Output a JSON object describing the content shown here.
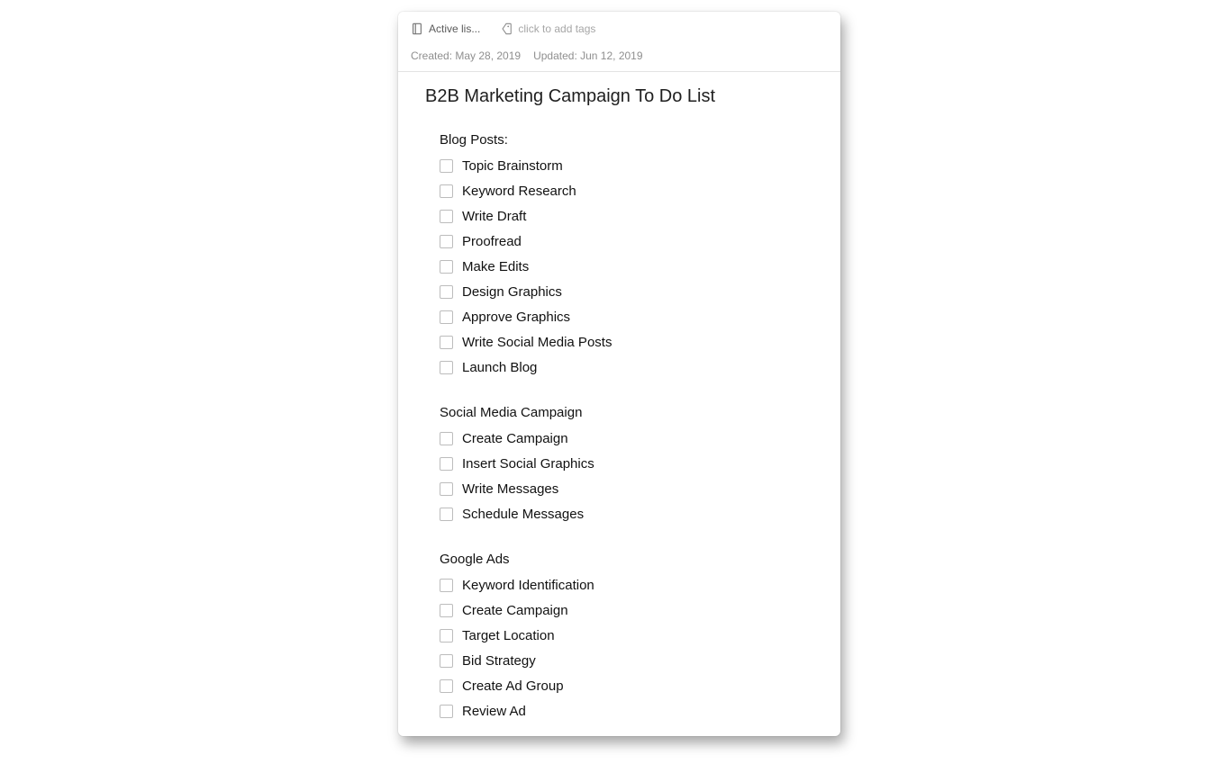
{
  "header": {
    "notebook_label": "Active lis...",
    "tags_placeholder": "click to add tags"
  },
  "meta": {
    "created": "Created: May 28, 2019",
    "updated": "Updated: Jun 12, 2019"
  },
  "note": {
    "title": "B2B Marketing Campaign To Do List"
  },
  "sections": [
    {
      "heading": "Blog Posts:",
      "items": [
        "Topic Brainstorm",
        "Keyword Research",
        "Write Draft",
        "Proofread",
        "Make Edits",
        "Design Graphics",
        "Approve Graphics",
        "Write Social Media Posts",
        "Launch Blog"
      ]
    },
    {
      "heading": "Social Media Campaign",
      "items": [
        "Create Campaign",
        "Insert Social Graphics",
        "Write Messages",
        "Schedule Messages"
      ]
    },
    {
      "heading": "Google Ads",
      "items": [
        "Keyword Identification",
        "Create Campaign",
        "Target Location",
        "Bid Strategy",
        "Create Ad Group",
        "Review Ad"
      ]
    }
  ]
}
